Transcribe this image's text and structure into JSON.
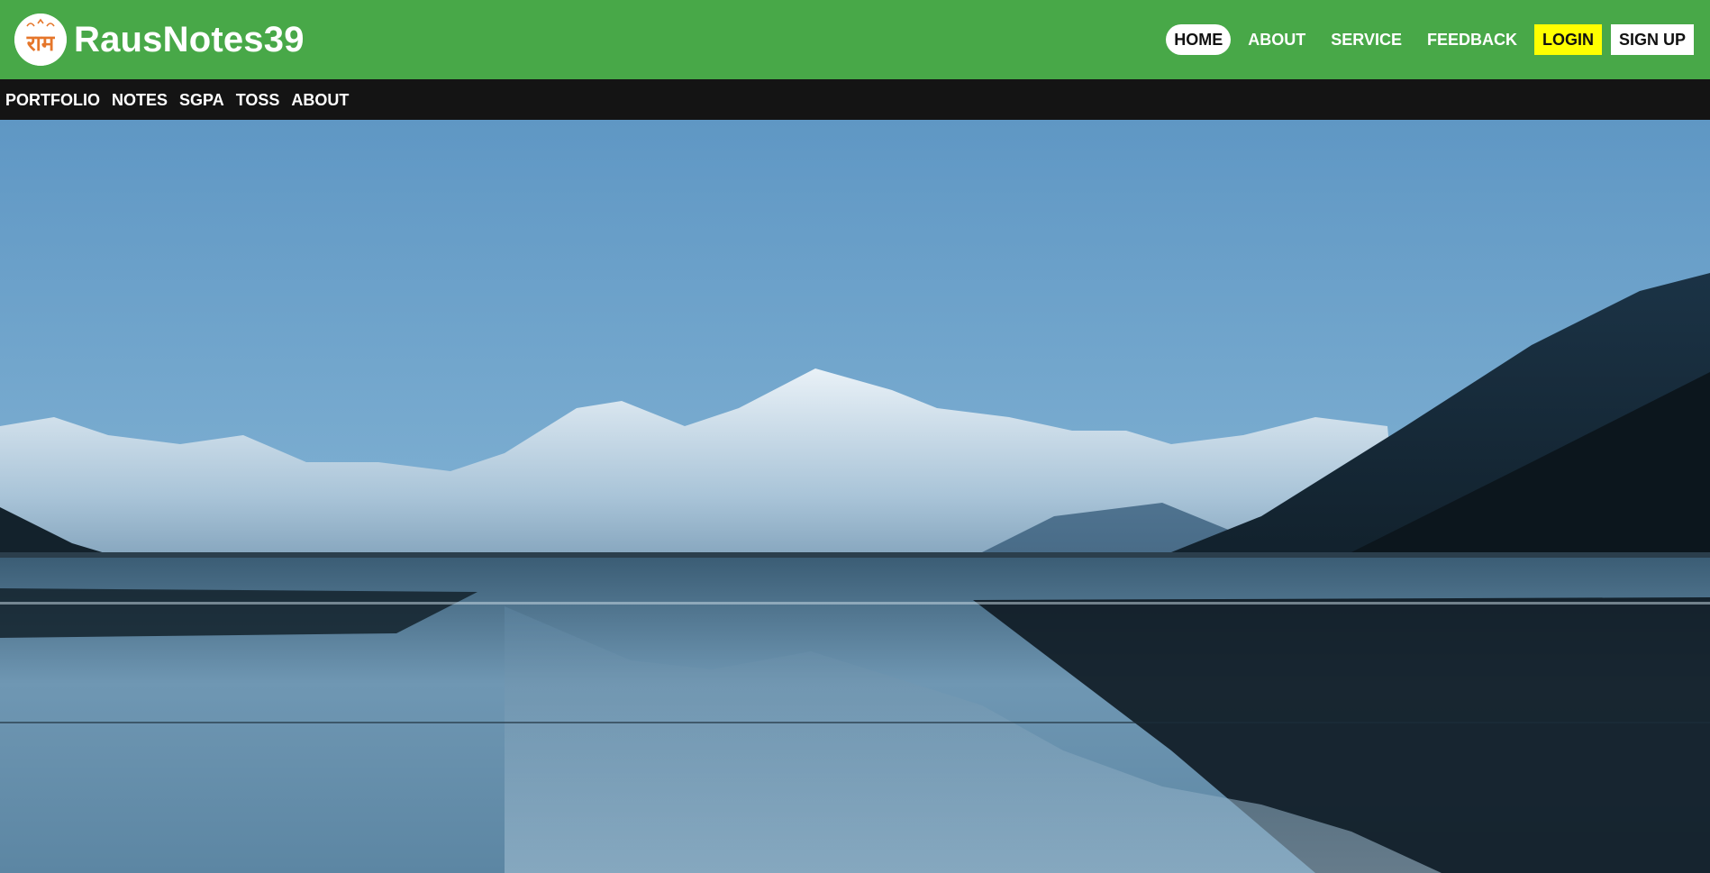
{
  "colors": {
    "topbar_bg": "#48a848",
    "subbar_bg": "#141414",
    "login_bg": "#ffff00",
    "logo_accent": "#e5762a"
  },
  "brand": {
    "name": "RausNotes39",
    "logo_icon": "ram-logo-icon",
    "logo_glyph": "राम"
  },
  "topnav": {
    "items": [
      {
        "label": "HOME",
        "active": true
      },
      {
        "label": "ABOUT"
      },
      {
        "label": "SERVICE"
      },
      {
        "label": "FEEDBACK"
      },
      {
        "label": "LOGIN"
      },
      {
        "label": "SIGN UP"
      }
    ]
  },
  "subnav": {
    "items": [
      {
        "label": "PORTFOLIO"
      },
      {
        "label": "NOTES"
      },
      {
        "label": "SGPA"
      },
      {
        "label": "TOSS"
      },
      {
        "label": "ABOUT"
      }
    ]
  },
  "hero": {
    "image_icon": "mountain-lake-landscape"
  }
}
